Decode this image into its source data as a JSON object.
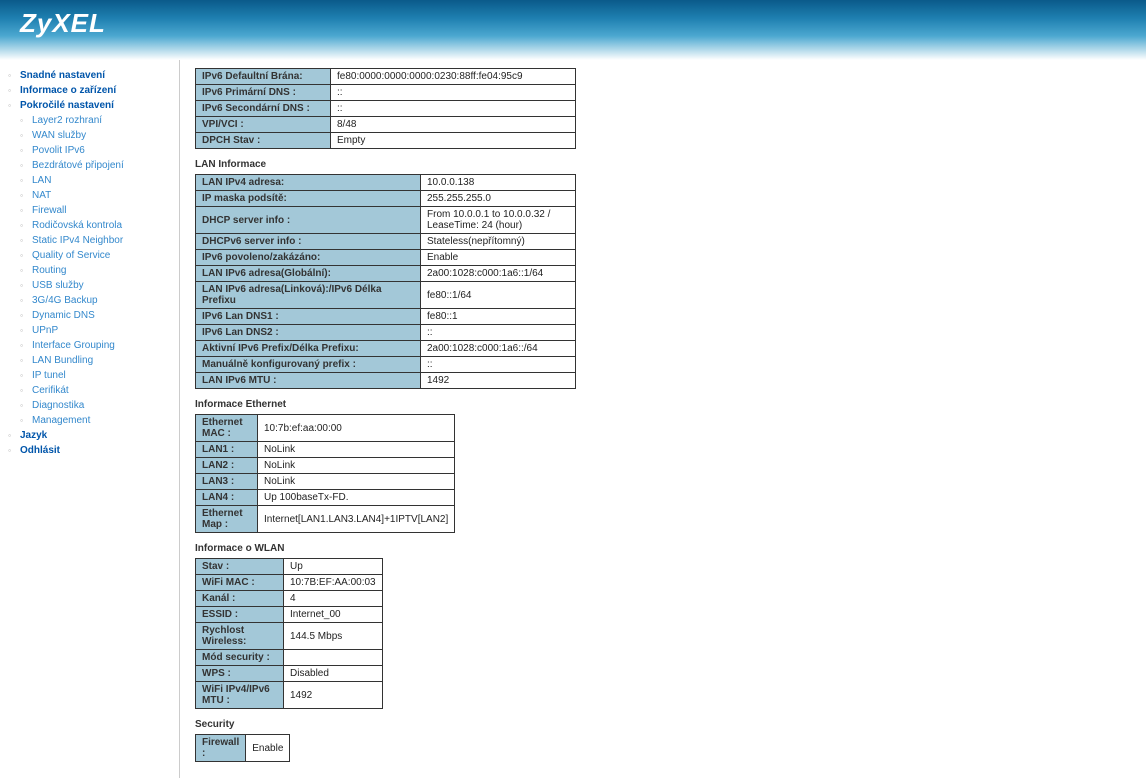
{
  "logo": "ZyXEL",
  "nav": {
    "snadne": "Snadné nastavení",
    "informace": "Informace o zařízení",
    "pokrocile": "Pokročilé nastavení",
    "sub": {
      "layer2": "Layer2 rozhraní",
      "wan": "WAN služby",
      "ipv6": "Povolit IPv6",
      "bezdratove": "Bezdrátové připojení",
      "lan": "LAN",
      "nat": "NAT",
      "firewall": "Firewall",
      "rodicovska": "Rodičovská kontrola",
      "staticipv4": "Static IPv4 Neighbor",
      "qos": "Quality of Service",
      "routing": "Routing",
      "usb": "USB služby",
      "backup34g": "3G/4G Backup",
      "dyndns": "Dynamic DNS",
      "upnp": "UPnP",
      "intgroup": "Interface Grouping",
      "lanbund": "LAN Bundling",
      "iptunel": "IP tunel",
      "cert": "Cerifikát",
      "diag": "Diagnostika",
      "mgmt": "Management"
    },
    "jazyk": "Jazyk",
    "odhlasit": "Odhlásit"
  },
  "sections": {
    "lan": "LAN Informace",
    "ethernet": "Informace Ethernet",
    "wlan": "Informace o WLAN",
    "security": "Security"
  },
  "wan": [
    {
      "label": "IPv6 Defaultní Brána:",
      "value": "fe80:0000:0000:0000:0230:88ff:fe04:95c9"
    },
    {
      "label": "IPv6 Primární DNS :",
      "value": "::"
    },
    {
      "label": "IPv6 Secondární DNS :",
      "value": "::"
    },
    {
      "label": "VPI/VCI :",
      "value": "8/48"
    },
    {
      "label": "DPCH Stav :",
      "value": "Empty"
    }
  ],
  "lan": [
    {
      "label": "LAN IPv4 adresa:",
      "value": "10.0.0.138"
    },
    {
      "label": "IP maska podsítě:",
      "value": "255.255.255.0"
    },
    {
      "label": "DHCP server info :",
      "value": "From 10.0.0.1 to 10.0.0.32 / LeaseTime: 24 (hour)"
    },
    {
      "label": "DHCPv6 server info :",
      "value": "Stateless(nepřítomný)"
    },
    {
      "label": "IPv6 povoleno/zakázáno:",
      "value": "Enable"
    },
    {
      "label": "LAN IPv6 adresa(Globální):",
      "value": "2a00:1028:c000:1a6::1/64"
    },
    {
      "label": "LAN IPv6 adresa(Linková):/IPv6 Délka Prefixu",
      "value": "fe80::1/64"
    },
    {
      "label": "IPv6 Lan DNS1 :",
      "value": "fe80::1"
    },
    {
      "label": "IPv6 Lan DNS2 :",
      "value": "::"
    },
    {
      "label": "Aktivní IPv6 Prefix/Délka Prefixu:",
      "value": "2a00:1028:c000:1a6::/64"
    },
    {
      "label": "Manuálně konfigurovaný prefix :",
      "value": "::"
    },
    {
      "label": "LAN IPv6 MTU :",
      "value": "1492"
    }
  ],
  "ethernet": [
    {
      "label": "Ethernet MAC :",
      "value": "10:7b:ef:aa:00:00"
    },
    {
      "label": "LAN1 :",
      "value": "NoLink"
    },
    {
      "label": "LAN2 :",
      "value": "NoLink"
    },
    {
      "label": "LAN3 :",
      "value": "NoLink"
    },
    {
      "label": "LAN4 :",
      "value": "Up 100baseTx-FD."
    },
    {
      "label": "Ethernet Map :",
      "value": "Internet[LAN1.LAN3.LAN4]+1IPTV[LAN2]"
    }
  ],
  "wlan": [
    {
      "label": "Stav :",
      "value": "Up"
    },
    {
      "label": "WiFi MAC :",
      "value": "10:7B:EF:AA:00:03"
    },
    {
      "label": "Kanál :",
      "value": "4"
    },
    {
      "label": "ESSID :",
      "value": "Internet_00"
    },
    {
      "label": "Rychlost Wireless:",
      "value": "144.5 Mbps"
    },
    {
      "label": "Mód security :",
      "value": ""
    },
    {
      "label": "WPS :",
      "value": "Disabled"
    },
    {
      "label": "WiFi IPv4/IPv6 MTU :",
      "value": "1492"
    }
  ],
  "security": [
    {
      "label": "Firewall :",
      "value": "Enable"
    }
  ]
}
